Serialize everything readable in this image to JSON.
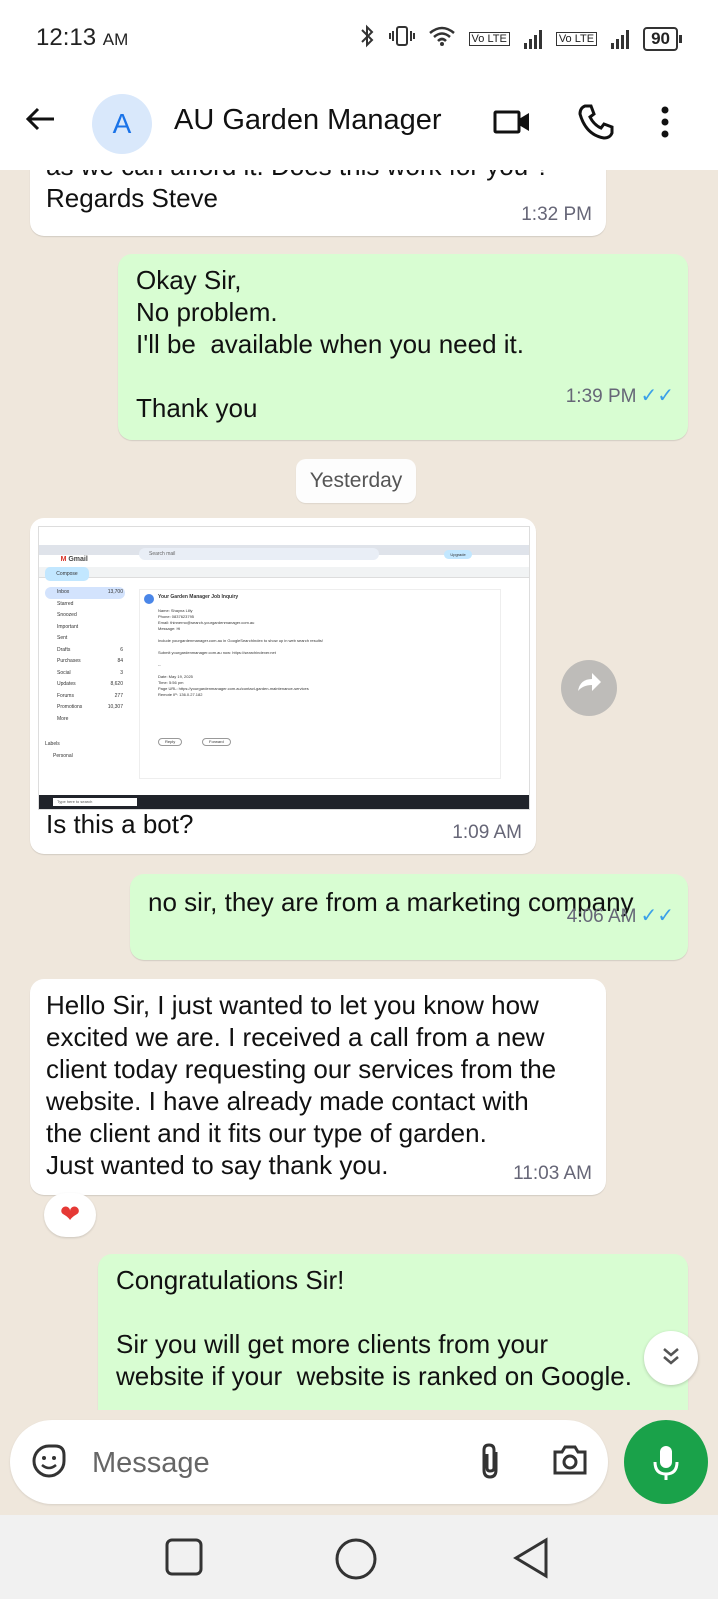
{
  "status": {
    "time": "12:13",
    "ampm": "AM",
    "battery": "90",
    "lte1": "Vo LTE",
    "lte2": "Vo LTE"
  },
  "header": {
    "avatar_letter": "A",
    "title": "AU Garden Manager"
  },
  "messages": [
    {
      "dir": "in",
      "text": "as we can afford it. Does this work for you ?\nRegards Steve",
      "time": "1:32 PM"
    },
    {
      "dir": "out",
      "text": "Okay Sir,\nNo problem.\nI'll be  available when you need it.\n\nThank you",
      "time": "1:39 PM"
    },
    {
      "dir": "in",
      "text": "Is this a bot?",
      "time": "1:09 AM"
    },
    {
      "dir": "out",
      "text": "no sir, they are from a marketing company",
      "time": "4:06 AM"
    },
    {
      "dir": "in",
      "text": "Hello Sir, I just wanted to let you know how\nexcited we are. I received a call from a new\nclient today requesting our services from the\nwebsite. I have already made contact with\nthe client and it fits our type of garden.\nJust wanted to say thank you.",
      "time": "11:03 AM"
    },
    {
      "dir": "out",
      "text": "Congratulations Sir!\n\nSir you will get more clients from your\nwebsite if your  website is ranked on Google.",
      "time": ""
    }
  ],
  "date_separator": "Yesterday",
  "reaction": "❤",
  "screenshot": {
    "app": "Gmail",
    "compose": "Compose",
    "search_placeholder": "Search mail",
    "upgrade": "Upgrade",
    "folders": [
      {
        "name": "Inbox",
        "count": "13,700"
      },
      {
        "name": "Starred",
        "count": ""
      },
      {
        "name": "Snoozed",
        "count": ""
      },
      {
        "name": "Important",
        "count": ""
      },
      {
        "name": "Sent",
        "count": ""
      },
      {
        "name": "Drafts",
        "count": "6"
      },
      {
        "name": "Purchases",
        "count": "84"
      },
      {
        "name": "Social",
        "count": "3"
      },
      {
        "name": "Updates",
        "count": "8,620"
      },
      {
        "name": "Forums",
        "count": "277"
      },
      {
        "name": "Promotions",
        "count": "10,307"
      },
      {
        "name": "More",
        "count": ""
      }
    ],
    "labels_heading": "Labels",
    "label_personal": "Personal",
    "email_subject": "Your Garden Manager Job Inquiry",
    "email_lines": [
      "Name: Shayna Lilly",
      "Phone: 0837623795",
      "Email: thinnerno@search-yourgardenmanager.com.au",
      "Message: Hi",
      "",
      "Include yourgardenmanager.com.au in GoogleSearchIndex to show up in web search results!",
      "",
      "Submit yourgardenmanager.com.au now: https://searchindexer.net",
      "",
      "--",
      "",
      "Date: May 19, 2025",
      "Time: 5:56 pm",
      "Page URL: https://yourgardenmanager.com.au/contact-garden-maintenance-services",
      "Remote IP: 136.0.27.182"
    ],
    "reply": "Reply",
    "forward": "Forward",
    "taskbar_search": "Type here to search"
  },
  "composer": {
    "placeholder": "Message"
  }
}
